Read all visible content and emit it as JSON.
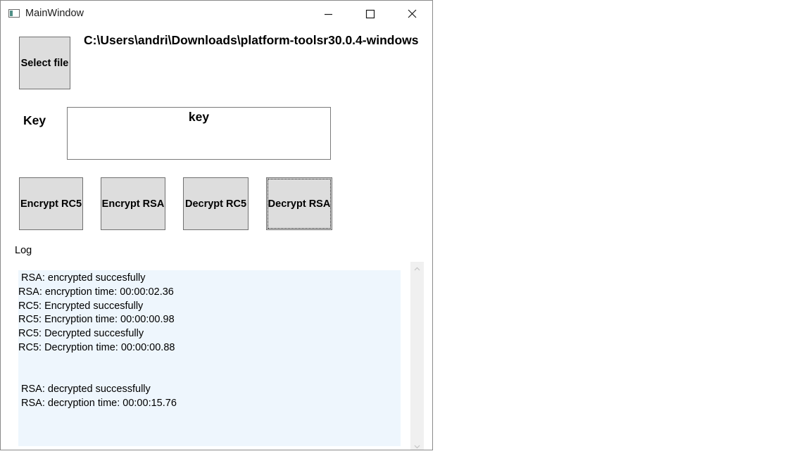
{
  "window": {
    "title": "MainWindow"
  },
  "file": {
    "select_label": "Select file",
    "path": "C:\\Users\\andri\\Downloads\\platform-toolsr30.0.4-windows"
  },
  "key": {
    "label": "Key",
    "value": "key"
  },
  "actions": {
    "encrypt_rc5": "Encrypt RC5",
    "encrypt_rsa": "Encrypt RSA",
    "decrypt_rc5": "Decrypt RC5",
    "decrypt_rsa": "Decrypt RSA"
  },
  "log": {
    "label": "Log",
    "lines": [
      " RSA: encrypted succesfully",
      "RSA: encryption time: 00:00:02.36",
      "RC5: Encrypted succesfully",
      "RC5: Encryption time: 00:00:00.98",
      "RC5: Decrypted succesfully",
      "RC5: Decryption time: 00:00:00.88",
      "",
      "",
      " RSA: decrypted successfully",
      " RSA: decryption time: 00:00:15.76"
    ]
  },
  "icons": {
    "app": "app-window-icon",
    "minimize": "minimize-icon",
    "maximize": "maximize-icon",
    "close": "close-icon",
    "scroll_up": "chevron-up-icon",
    "scroll_down": "chevron-down-icon"
  },
  "colors": {
    "button_bg": "#dddddd",
    "log_bg": "#eef6fd",
    "scrollbar_bg": "#f0f0f0"
  }
}
